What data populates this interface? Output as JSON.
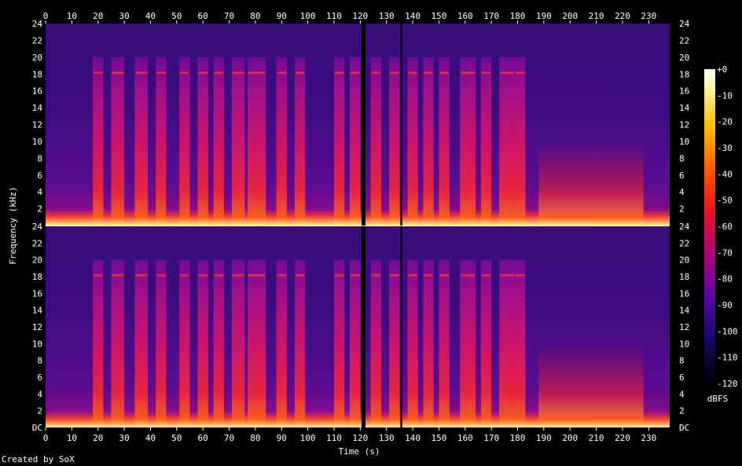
{
  "chart_data": {
    "type": "heatmap",
    "xlabel": "Time (s)",
    "ylabel": "Frequency (kHz)",
    "xlim": [
      0,
      238
    ],
    "ylim": [
      0,
      24
    ],
    "x_ticks": [
      0,
      10,
      20,
      30,
      40,
      50,
      60,
      70,
      80,
      90,
      100,
      110,
      120,
      130,
      140,
      150,
      160,
      170,
      180,
      190,
      200,
      210,
      220,
      230
    ],
    "y_ticks_top": [
      "2",
      "4",
      "6",
      "8",
      "10",
      "12",
      "14",
      "16",
      "18",
      "20",
      "22",
      "24"
    ],
    "y_ticks_bottom": [
      "DC",
      "2",
      "4",
      "6",
      "8",
      "10",
      "12",
      "14",
      "16",
      "18",
      "20",
      "22",
      "24"
    ],
    "channels": 2,
    "colorbar": {
      "label": "dBFS",
      "ticks": [
        "+0",
        "-10",
        "-20",
        "-30",
        "-40",
        "-50",
        "-60",
        "-70",
        "-80",
        "-90",
        "-100",
        "-110",
        "-120"
      ],
      "range": [
        -120,
        0
      ]
    },
    "silent_gaps_s": [
      [
        120.5,
        122.0
      ],
      [
        135.3,
        136.0
      ]
    ],
    "bursts_s": [
      [
        18,
        22
      ],
      [
        25,
        30
      ],
      [
        34,
        39
      ],
      [
        42,
        46
      ],
      [
        51,
        55
      ],
      [
        58,
        62
      ],
      [
        64,
        68
      ],
      [
        71,
        76
      ],
      [
        77,
        84
      ],
      [
        88,
        92
      ],
      [
        95,
        99
      ],
      [
        110,
        114
      ],
      [
        116,
        120
      ],
      [
        124,
        128
      ],
      [
        131,
        135
      ],
      [
        138,
        142
      ],
      [
        144,
        148
      ],
      [
        150,
        154
      ],
      [
        158,
        164
      ],
      [
        166,
        170
      ],
      [
        173,
        179
      ],
      [
        179,
        183
      ]
    ],
    "colors": {
      "background": "#000000",
      "low": "#2a0c5c",
      "mid": "#c0166a",
      "high": "#ff3a10",
      "peak": "#fff4b0"
    }
  },
  "footer": "Created by SoX"
}
